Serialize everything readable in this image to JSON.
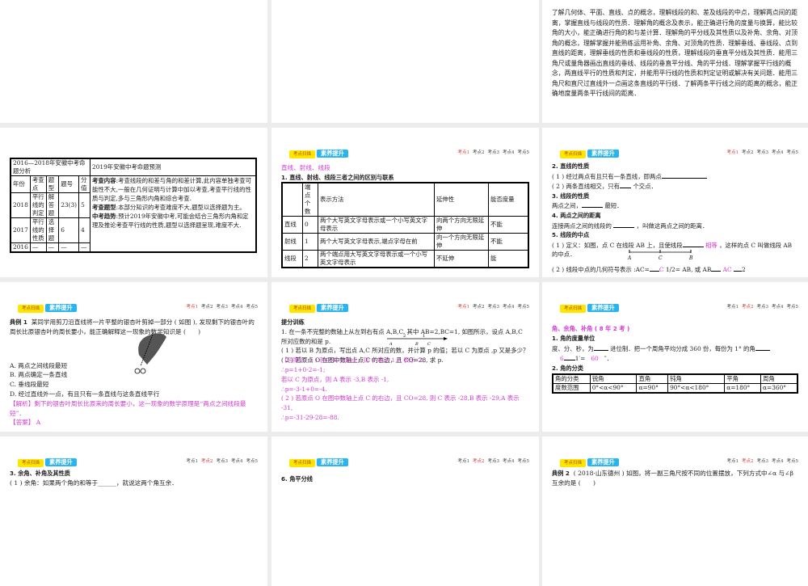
{
  "nav_tags": {
    "scan": "考点扫描",
    "improve": "素养提升"
  },
  "nav_points": [
    "考点1",
    "考点2",
    "考点3",
    "考点4",
    "考点5"
  ],
  "slide_goals": {
    "text": "了解几何体、平面、直线、点的概念，理解线段的和、差及线段的中点，理解两点间的距离，掌握直线与线段的性质．理解角的概念及表示，能正确进行角的度量与换算，能比较角的大小，能正确进行角的和与差计算．理解角的平分线及其性质以及补角、余角、对顶角的概念，理解掌握并能熟练运用补角、余角、对顶角的性质．理解垂线、垂线段、点到直线的距离，理解垂线的性质和垂线段的性质，理解线段的垂直平分线及其性质．能用三角尺或量角器画出直线的垂线、线段的垂直平分线、角的平分线．理解掌握平行线的概念，两直线平行的性质和判定，并能用平行线的性质和判定证明或解决有关问题．能用三角尺和直尺过直线外一点画这条直线的平行线．了解两条平行线之间的距离的概念，能正确地度量两条平行线间的距离．"
  },
  "slide_analysis": {
    "h1": "2016—2018年安徽中考命题分析",
    "h2": "2019年安徽中考命题预测",
    "cols": [
      "年份",
      "考查点",
      "题型",
      "题号",
      "分值"
    ],
    "rows": [
      [
        "2018",
        "平行线的判定",
        "解答题",
        "23(3)",
        "5"
      ],
      [
        "2017",
        "平行线的性质",
        "选择题",
        "6",
        "4"
      ],
      [
        "2016",
        "—",
        "—",
        "—",
        "—"
      ]
    ],
    "content_label": "考查内容",
    "content": ":考查线段的和差与角的和差计算,此内容单独考查可能性不大,一般在几何证明与计算中加以考查,考查平行线的性质与判定,多与三角形内角和综合考查.",
    "type_label": "考查题型",
    "type": ":本部分知识的考查难度不大,题型以选择题为主。",
    "trend_label": "中考趋势",
    "trend": ":预计2019年安徽中考,可能会结合三角形内角和定理及推论考查平行线的性质,题型以选择题呈现,难度不大."
  },
  "slide_lines": {
    "title": "直线、射线、线段",
    "sub": "1. 直线、射线、线段三者之间的区别与联系",
    "cols": [
      "",
      "端点个数",
      "表示方法",
      "延伸性",
      "能否度量"
    ],
    "rows": [
      [
        "直线",
        "0",
        "两个大写英文字母表示或一个小写英文字母表示",
        "向两个方向无限延伸",
        "不能"
      ],
      [
        "射线",
        "1",
        "两个大写英文字母表示,端点字母在前",
        "向一个方向无限延伸",
        "不能"
      ],
      [
        "线段",
        "2",
        "两个端点用大写英文字母表示或一个小写英文字母表示",
        "不延伸",
        "能"
      ]
    ]
  },
  "slide_props": {
    "h2": "2. 直线的性质",
    "l1": "( 1 ) 经过两点有且只有一条直线，即两点",
    "l2a": "( 2 ) 两条直线相交，只有",
    "l2b": "个交点．",
    "h3": "3. 线段的性质",
    "l3a": "两点之间，",
    "l3b": "最短．",
    "h4": "4. 两点之间的距离",
    "l4a": "连接两点之间的线段的",
    "l4b": "，叫做这两点之间的距离．",
    "h5": "5. 线段的中点",
    "l5a": "( 1 ) 定义：如图，点 C 在线段 AB 上，且使线段",
    "l5ans": "相等",
    "l5b": "，这样的点 C 叫做线段 AB 的中点．",
    "pts": [
      "A",
      "C",
      "B"
    ],
    "l6a": "( 2 ) 线段中点的几何符号表示 :AC=",
    "l6c": "C",
    "l6half": "1/2=",
    "l6b": "AB, 或 AB",
    "l6ac": "AC",
    "l6d": "2"
  },
  "slide_ex1": {
    "label": "典例 1",
    "q": "某同学用剪刀沿直线将一片平整的银杏叶剪掉一部分 ( 如图 ), 发现剩下的银杏叶的周长比原银杏叶的周长要小，能正确解释这一现象的数学知识是 (　　)",
    "opts": [
      "A. 两点之间线段最短",
      "B. 两点确定一条直线",
      "C. 垂线段最短",
      "D. 经过直线外一点，有且只有一条直线与这条直线平行"
    ],
    "analysis": "【解析】剩下的银杏叶周长比原来的周长要小，这一现象的数学原理是“两点之间线段最短”．",
    "answer_label": "【答案】",
    "answer": "A"
  },
  "slide_train": {
    "title": "提分训练",
    "q1": "1. 在一条不完整的数轴上从左到右有点 A,B,C. 其中 AB=2,BC=1, 如图所示，设点 A,B,C 所对应数的和是 p.",
    "axis": [
      "A",
      "B",
      "C",
      "2",
      "1"
    ],
    "q1a": "( 1 ) 若以 B 为原点，写出点 A,C 所对应的数，并计算 p 的值；若以 C 为原点 ,p 又是多少？",
    "q1b": "( 2 ) 若原点 O 在图中数轴上点 C 的右边，且 CO=28, 求 p.",
    "ans": [
      "【答案】( 1 ) 若以 B 为原点，则 C 表示 1,A 表示 -2,",
      "∴p=1+0-2=-1;",
      "若以 C 为原点，则 A 表示 -3,B 表示 -1,",
      "∴p=-3-1+0=-4.",
      "( 2 ) 若原点 O 在图中数轴上点 C 的右边，且 CO=28, 则 C 表示 -28,B 表示 -29,A 表示 -31,",
      "∴p=-31-29-28=-88."
    ]
  },
  "slide_angle": {
    "title": "角、余角、补角 ( 8 年 2 考 )",
    "h1": "1. 角的度量单位",
    "l1a": "度、分、秒，为",
    "l1b": "进位制．把一个周角平均分成 360 份，每份为 1° 的角",
    "l2a": "6",
    "l2b": "1′=",
    "l2c": "60",
    "l2d": "″．",
    "h2": "2. 角的分类",
    "rows": [
      [
        "角的分类",
        "锐角",
        "直角",
        "钝角",
        "平角",
        "周角"
      ],
      [
        "度数范围",
        "0°<α<90°",
        "α=90°",
        "90°<α<180°",
        "α=180°",
        "α=360°"
      ]
    ]
  },
  "slide_r4a": {
    "h": "3. 余角、补角及其性质",
    "l": "( 1 ) 余角：如果两个角的和等于______，就说这两个角互余．"
  },
  "slide_r4b": {
    "h": "6. 角平分线"
  },
  "slide_r4c": {
    "label": "典例 2",
    "q": "( 2018·山东德州 ) 如图，将一副三角尺按不同的位置摆放，下列方式中∠α 与∠β 互余的是 (　　)"
  }
}
